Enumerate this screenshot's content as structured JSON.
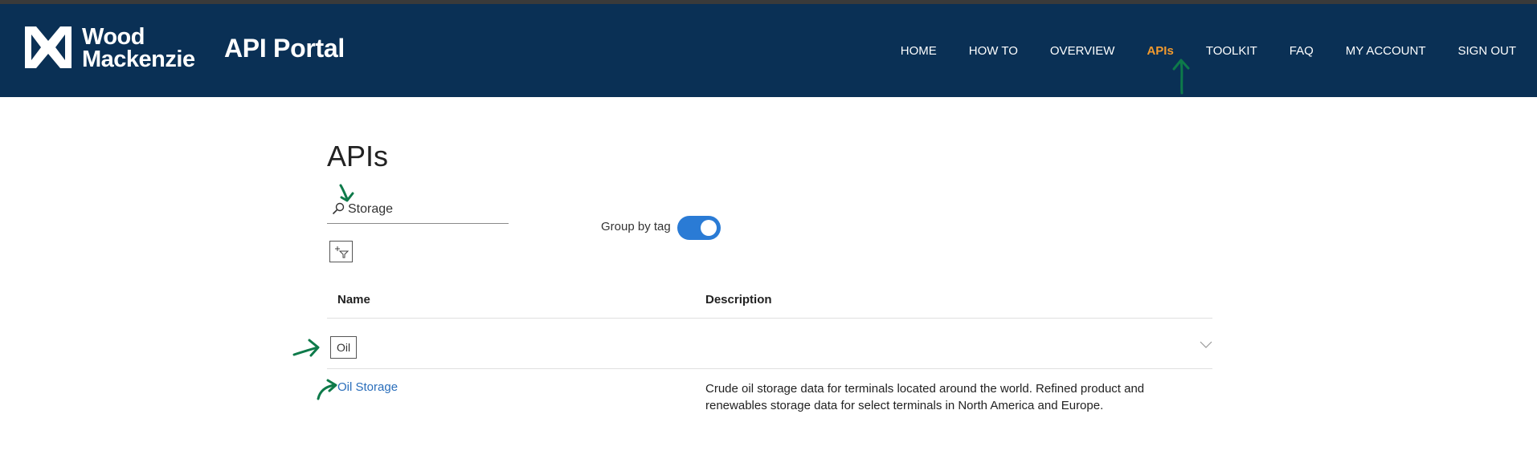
{
  "brand": {
    "name_line1": "Wood",
    "name_line2": "Mackenzie",
    "portal_title": "API Portal"
  },
  "nav": {
    "items": [
      {
        "label": "HOME",
        "active": false
      },
      {
        "label": "HOW TO",
        "active": false
      },
      {
        "label": "OVERVIEW",
        "active": false
      },
      {
        "label": "APIs",
        "active": true
      },
      {
        "label": "TOOLKIT",
        "active": false
      },
      {
        "label": "FAQ",
        "active": false
      },
      {
        "label": "MY ACCOUNT",
        "active": false
      },
      {
        "label": "SIGN OUT",
        "active": false
      }
    ]
  },
  "page": {
    "title": "APIs"
  },
  "search": {
    "value": "Storage",
    "icon": "search-icon"
  },
  "filter": {
    "icon": "add-filter-icon"
  },
  "group_by_tag": {
    "label": "Group by tag",
    "enabled": true
  },
  "table": {
    "columns": {
      "name": "Name",
      "description": "Description"
    },
    "groups": [
      {
        "tag": "Oil",
        "rows": [
          {
            "name": "Oil Storage",
            "description": "Crude oil storage data for terminals located around the world. Refined product and renewables storage data for select terminals in North America and Europe."
          }
        ]
      }
    ]
  },
  "colors": {
    "header_bg": "#0a3055",
    "nav_active": "#f29a2e",
    "toggle_on": "#2a7bd5",
    "link": "#2a6ebb",
    "annotation": "#0e7a4a"
  }
}
